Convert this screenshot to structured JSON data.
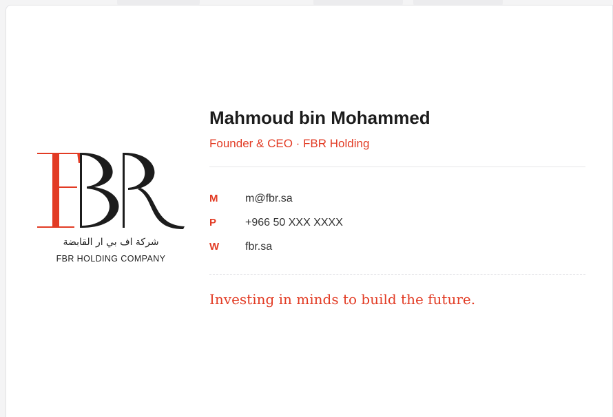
{
  "logo": {
    "letters": "FBR",
    "arabic_line": "شركة اف بي ار القابضة",
    "english_line": "FBR HOLDING COMPANY",
    "accent_color": "#e23b24",
    "dark_color": "#1c1c1c"
  },
  "person": {
    "name": "Mahmoud bin Mohammed",
    "role": "Founder & CEO · FBR Holding"
  },
  "contacts": [
    {
      "key": "M",
      "value": "m@fbr.sa"
    },
    {
      "key": "P",
      "value": "+966 50 XXX XXXX"
    },
    {
      "key": "W",
      "value": "fbr.sa"
    }
  ],
  "tagline": "Investing in minds to build the future.",
  "colors": {
    "accent": "#e23b24",
    "text": "#1c1c1c",
    "background": "#ffffff"
  }
}
